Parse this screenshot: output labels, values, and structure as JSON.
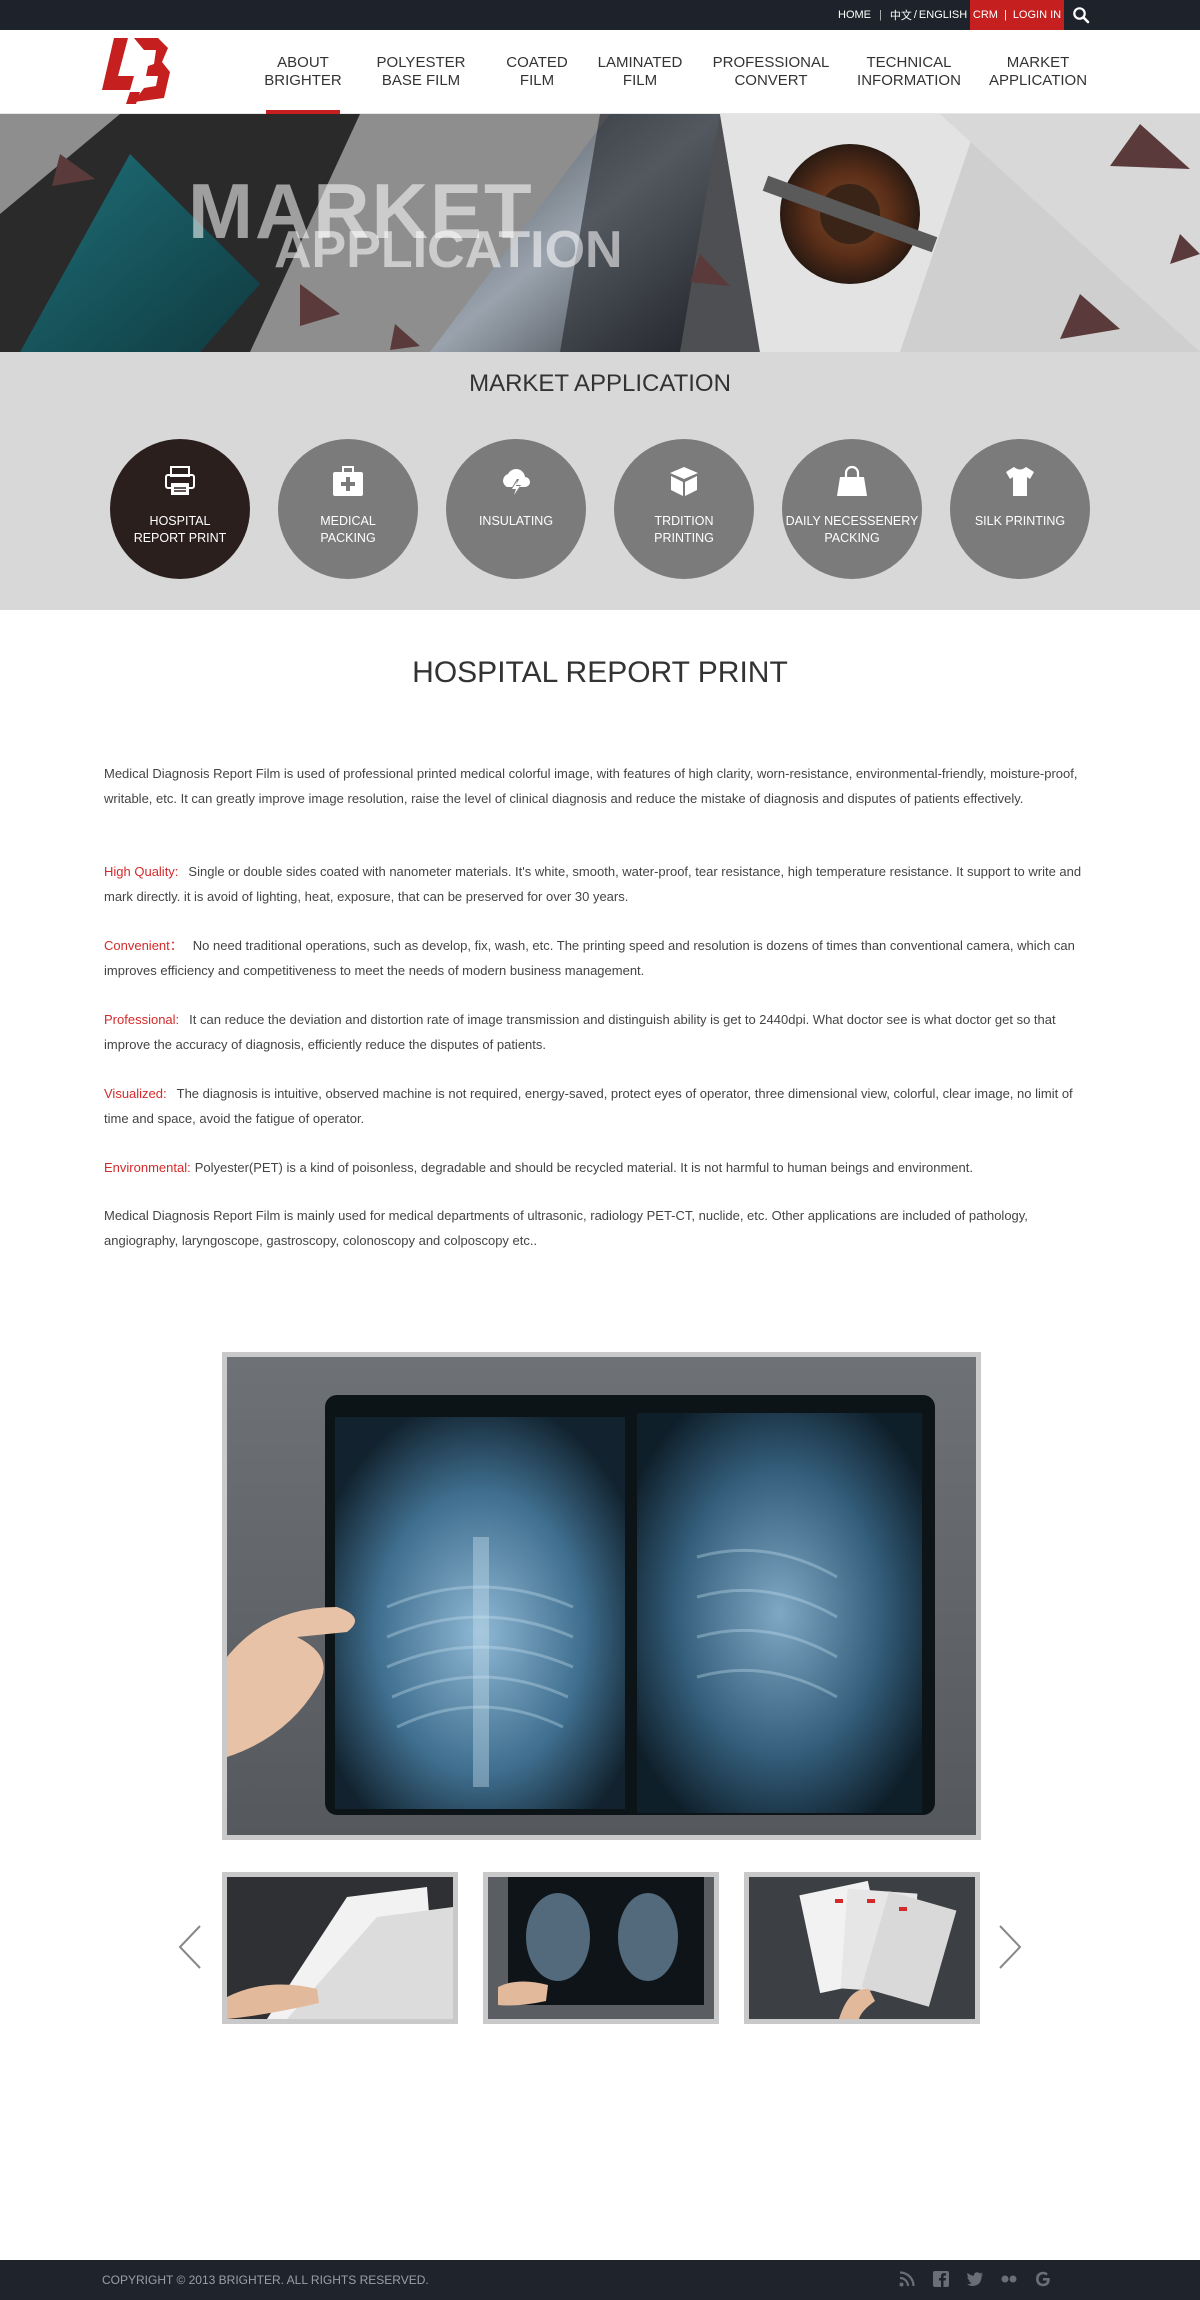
{
  "topbar": {
    "home": "HOME",
    "lang_cn": "中文",
    "lang_sep": "/",
    "lang_en": "ENGLISH",
    "crm": "CRM",
    "login": "LOGIN IN"
  },
  "nav": [
    {
      "label": "ABOUT\nBRIGHTER"
    },
    {
      "label": "POLYESTER\nBASE FILM"
    },
    {
      "label": "COATED\nFILM"
    },
    {
      "label": "LAMINATED\nFILM"
    },
    {
      "label": "PROFESSIONAL\nCONVERT"
    },
    {
      "label": "TECHNICAL\nINFORMATION"
    },
    {
      "label": "MARKET\nAPPLICATION"
    }
  ],
  "banner": {
    "line1": "MARKET",
    "line2": "APPLICATION"
  },
  "market": {
    "title": "MARKET APPLICATION",
    "categories": [
      {
        "label": "HOSPITAL\nREPORT PRINT",
        "icon": "printer-icon"
      },
      {
        "label": "MEDICAL\nPACKING",
        "icon": "medical-kit-icon"
      },
      {
        "label": "INSULATING",
        "icon": "cloud-lightning-icon"
      },
      {
        "label": "TRDITION\nPRINTING",
        "icon": "box-icon"
      },
      {
        "label": "DAILY NECESSENERY\nPACKING",
        "icon": "bag-icon"
      },
      {
        "label": "SILK PRINTING",
        "icon": "tshirt-icon"
      }
    ]
  },
  "content": {
    "title": "HOSPITAL REPORT PRINT",
    "intro": "Medical Diagnosis Report Film is used of professional printed medical colorful image, with features of high clarity, worn-resistance, environmental-friendly, moisture-proof, writable, etc. It can greatly improve image resolution, raise the level of clinical diagnosis and reduce the mistake of diagnosis and disputes of patients effectively.",
    "features": [
      {
        "label": "High Quality:",
        "text": "Single or double sides coated with nanometer materials. It's white, smooth, water-proof, tear resistance, high temperature resistance. It support to write and mark directly. it is avoid of lighting, heat, exposure, that can be preserved for over 30 years."
      },
      {
        "label": "Convenient：",
        "text": "No need traditional operations, such as develop, fix, wash, etc. The printing speed and resolution is dozens of times than conventional camera, which can improves efficiency and competitiveness to meet the needs of modern business management."
      },
      {
        "label": "Professional:",
        "text": "It can reduce the deviation and distortion rate of image transmission and distinguish ability is get to 2440dpi. What doctor see is what doctor get so that improve the accuracy of diagnosis, efficiently reduce the disputes of patients."
      },
      {
        "label": "Visualized:",
        "text": "The diagnosis is intuitive, observed machine is not required, energy-saved, protect eyes of operator, three dimensional view, colorful, clear image, no limit of time and space, avoid the fatigue of operator."
      },
      {
        "label": "Environmental:",
        "text": "Polyester(PET) is a kind of poisonless, degradable and should be recycled material. It is not harmful to human beings and environment."
      }
    ],
    "outro": "Medical Diagnosis Report Film is mainly used for medical departments of ultrasonic, radiology PET-CT, nuclide, etc. Other applications are included of pathology, angiography, laryngoscope, gastroscopy, colonoscopy and colposcopy etc.."
  },
  "footer": {
    "copyright": "COPYRIGHT © 2013 BRIGHTER. ALL RIGHTS RESERVED.",
    "social": [
      "rss-icon",
      "facebook-icon",
      "twitter-icon",
      "flickr-icon",
      "google-icon"
    ]
  },
  "colors": {
    "accent": "#c5201f",
    "topbar": "#1e222a",
    "active_circle": "#2b1f1e",
    "circle": "#7b7b7b",
    "section_bg": "#d8d8d8"
  }
}
